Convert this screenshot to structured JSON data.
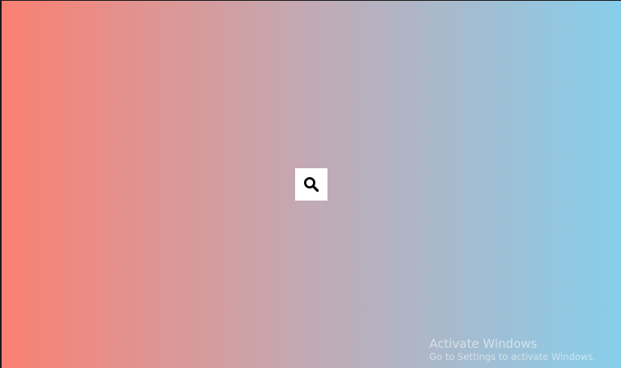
{
  "background": {
    "gradient_start": "#fa8072",
    "gradient_mid": "#c4a8b2",
    "gradient_end": "#87ceeb"
  },
  "search": {
    "icon": "search-icon",
    "button_bg": "#ffffff",
    "icon_color": "#000000"
  },
  "watermark": {
    "title": "Activate Windows",
    "subtitle": "Go to Settings to activate Windows."
  }
}
